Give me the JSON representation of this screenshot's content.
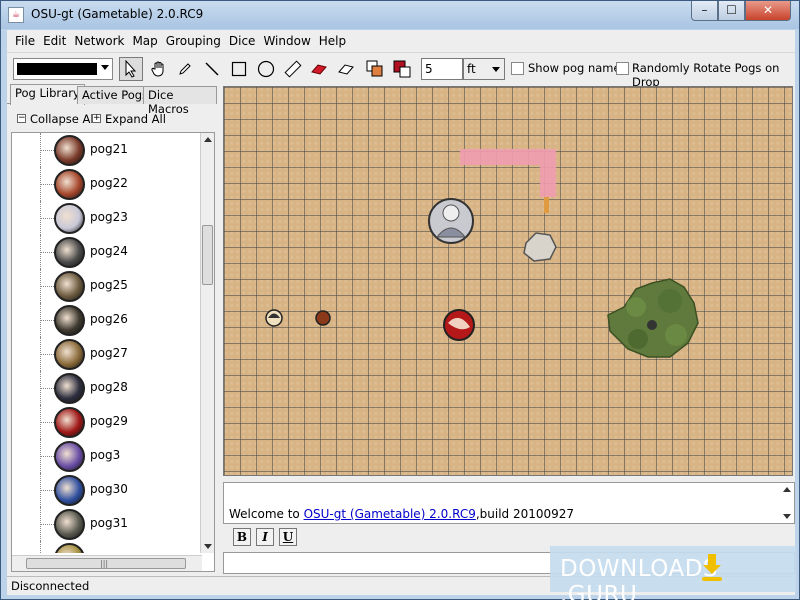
{
  "window": {
    "title": "OSU-gt (Gametable) 2.0.RC9",
    "controls": {
      "minimize": "–",
      "maximize": "☐",
      "close": "✕"
    }
  },
  "menubar": {
    "items": [
      "File",
      "Edit",
      "Network",
      "Map",
      "Grouping",
      "Dice",
      "Window",
      "Help"
    ]
  },
  "toolbar": {
    "current_color": "#000000",
    "tools": [
      "pointer-tool",
      "hand-tool",
      "pencil-tool",
      "line-tool",
      "rectangle-tool",
      "circle-tool",
      "ruler-tool",
      "red-eraser-tool",
      "eraser-tool",
      "layer-tool",
      "color-layer-tool"
    ],
    "selected_tool": "pointer-tool",
    "distance_value": "5",
    "distance_unit": "ft",
    "show_pog_names_label": "Show pog names",
    "random_rotate_label": "Randomly Rotate Pogs on Drop"
  },
  "left_panel": {
    "tabs": [
      "Pog Library",
      "Active Pogs",
      "Dice Macros"
    ],
    "active_tab": "Pog Library",
    "collapse_all": "Collapse All",
    "expand_all": "Expand All",
    "pogs": [
      {
        "label": "pog21",
        "color": "#7a3a2a"
      },
      {
        "label": "pog22",
        "color": "#a5462b"
      },
      {
        "label": "pog23",
        "color": "#c8c8d8"
      },
      {
        "label": "pog24",
        "color": "#4a4a4a"
      },
      {
        "label": "pog25",
        "color": "#6b5a3e"
      },
      {
        "label": "pog26",
        "color": "#3f3a30"
      },
      {
        "label": "pog27",
        "color": "#8a6a3a"
      },
      {
        "label": "pog28",
        "color": "#2f3040"
      },
      {
        "label": "pog29",
        "color": "#a01818"
      },
      {
        "label": "pog3",
        "color": "#6a4ea6"
      },
      {
        "label": "pog30",
        "color": "#3050a0"
      },
      {
        "label": "pog31",
        "color": "#5a5a50"
      },
      {
        "label": "",
        "color": "#a69040"
      }
    ]
  },
  "chat": {
    "welcome_prefix": "Welcome to ",
    "welcome_link": "OSU-gt (Gametable) 2.0.RC9",
    "welcome_suffix": ",build 20100927",
    "bold_label": "B",
    "italic_label": "I",
    "underline_label": "U"
  },
  "statusbar": {
    "status": "Disconnected"
  },
  "watermark": {
    "text": "DOWNLOADS",
    "suffix": ".GURU"
  }
}
